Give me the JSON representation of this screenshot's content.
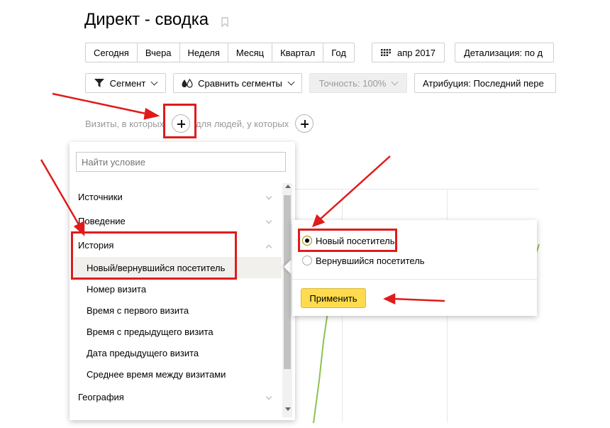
{
  "page": {
    "title": "Директ - сводка"
  },
  "periods": [
    "Сегодня",
    "Вчера",
    "Неделя",
    "Месяц",
    "Квартал",
    "Год"
  ],
  "date_button": {
    "label": "апр 2017",
    "icon": "calendar-grid-icon"
  },
  "detail_button": {
    "label": "Детализация: по д"
  },
  "toolbar": {
    "segment_label": "Сегмент",
    "compare_label": "Сравнить сегменты",
    "accuracy_label": "Точность: 100%",
    "attribution_label": "Атрибуция: Последний пере"
  },
  "conditions": {
    "visits_label": "Визиты, в которых",
    "people_label": "для людей, у которых"
  },
  "dropdown": {
    "search_placeholder": "Найти условие",
    "categories": [
      {
        "label": "Источники",
        "expanded": false
      },
      {
        "label": "Поведение",
        "expanded": false
      },
      {
        "label": "История",
        "expanded": true
      },
      {
        "label": "География",
        "expanded": false
      }
    ],
    "history_items": [
      "Новый/вернувшийся посетитель",
      "Номер визита",
      "Время с первого визита",
      "Время с предыдущего визита",
      "Дата предыдущего визита",
      "Среднее время между визитами"
    ],
    "selected_item": "Новый/вернувшийся посетитель"
  },
  "visitor_popup": {
    "options": [
      {
        "label": "Новый посетитель",
        "checked": true
      },
      {
        "label": "Вернувшийся посетитель",
        "checked": false
      }
    ],
    "apply_label": "Применить"
  },
  "colors": {
    "annotation_red": "#e01b1b",
    "apply_yellow": "#ffdb4d",
    "chart_line_green": "#8cc152"
  }
}
